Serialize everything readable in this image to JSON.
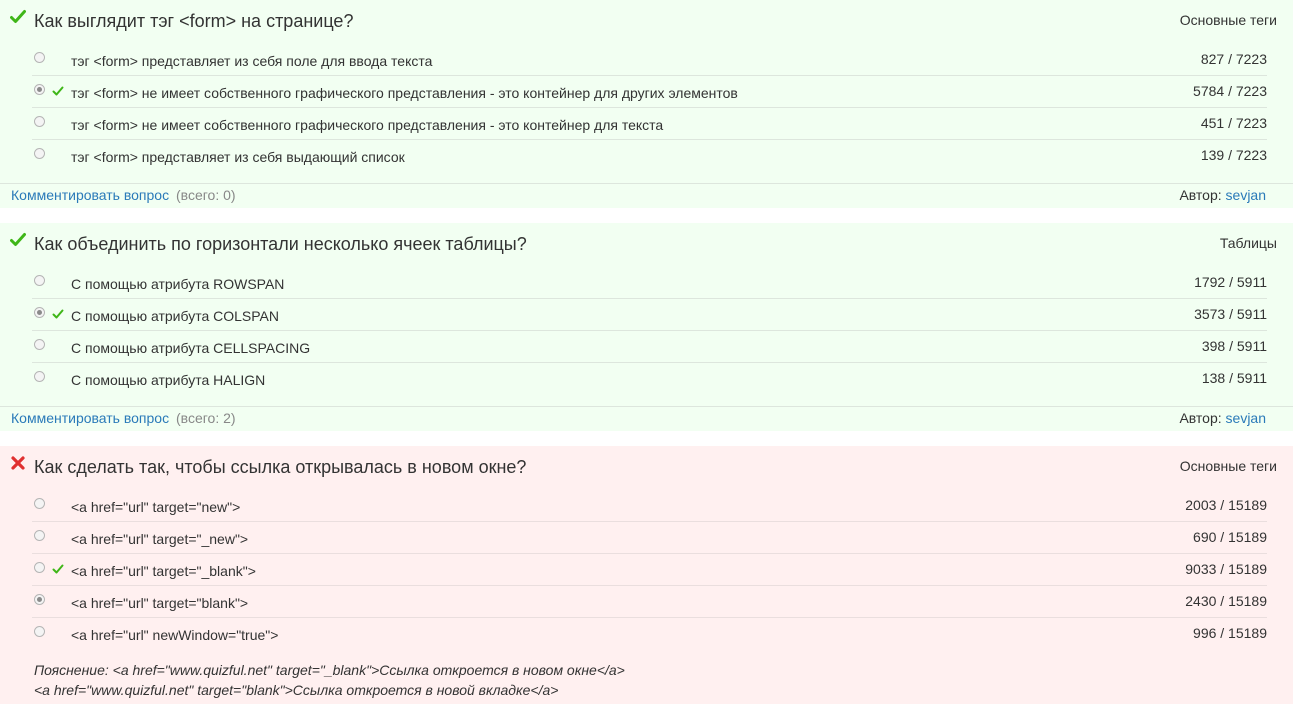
{
  "questions": [
    {
      "status": "correct",
      "status_icon": "check-icon",
      "title": "Как выглядит тэг <form> на странице?",
      "category": "Основные теги",
      "answers": [
        {
          "text": "тэг <form> представляет из себя поле для ввода текста",
          "count": "827 / 7223",
          "selected": false,
          "correct": false
        },
        {
          "text": "тэг <form> не имеет собственного графического представления - это контейнер для других элементов",
          "count": "5784 / 7223",
          "selected": true,
          "correct": true
        },
        {
          "text": "тэг <form> не имеет собственного графического представления - это контейнер для текста",
          "count": "451 / 7223",
          "selected": false,
          "correct": false
        },
        {
          "text": "тэг <form> представляет из себя выдающий список",
          "count": "139 / 7223",
          "selected": false,
          "correct": false
        }
      ],
      "comment_link": "Комментировать вопрос",
      "comment_count": "(всего: 0)",
      "author_label": "Автор:",
      "author_name": "sevjan"
    },
    {
      "status": "correct",
      "status_icon": "check-icon",
      "title": "Как объединить по горизонтали несколько ячеек таблицы?",
      "category": "Таблицы",
      "answers": [
        {
          "text": "С помощью атрибута ROWSPAN",
          "count": "1792 / 5911",
          "selected": false,
          "correct": false
        },
        {
          "text": "С помощью атрибута COLSPAN",
          "count": "3573 / 5911",
          "selected": true,
          "correct": true
        },
        {
          "text": "С помощью атрибута CELLSPACING",
          "count": "398 / 5911",
          "selected": false,
          "correct": false
        },
        {
          "text": "С помощью атрибута HALIGN",
          "count": "138 / 5911",
          "selected": false,
          "correct": false
        }
      ],
      "comment_link": "Комментировать вопрос",
      "comment_count": "(всего: 2)",
      "author_label": "Автор:",
      "author_name": "sevjan"
    },
    {
      "status": "wrong",
      "status_icon": "cross-icon",
      "title": "Как сделать так, чтобы ссылка открывалась в новом окне?",
      "category": "Основные теги",
      "answers": [
        {
          "text": "<a href=\"url\" target=\"new\">",
          "count": "2003 / 15189",
          "selected": false,
          "correct": false
        },
        {
          "text": "<a href=\"url\" target=\"_new\">",
          "count": "690 / 15189",
          "selected": false,
          "correct": false
        },
        {
          "text": "<a href=\"url\" target=\"_blank\">",
          "count": "9033 / 15189",
          "selected": false,
          "correct": true
        },
        {
          "text": "<a href=\"url\" target=\"blank\">",
          "count": "2430 / 15189",
          "selected": true,
          "correct": false
        },
        {
          "text": "<a href=\"url\" newWindow=\"true\">",
          "count": "996 / 15189",
          "selected": false,
          "correct": false
        }
      ],
      "explanation_line1": "Пояснение: <a href=\"www.quizful.net\" target=\"_blank\">Ссылка откроется в новом окне</a>",
      "explanation_line2": "<a href=\"www.quizful.net\" target=\"blank\">Ссылка откроется в новой вкладке</a>"
    }
  ],
  "colors": {
    "correct_bg": "#f2fff2",
    "wrong_bg": "#fff0f0",
    "link": "#2a7ab9",
    "check_green": "#3fb618",
    "cross_red": "#e03030"
  }
}
